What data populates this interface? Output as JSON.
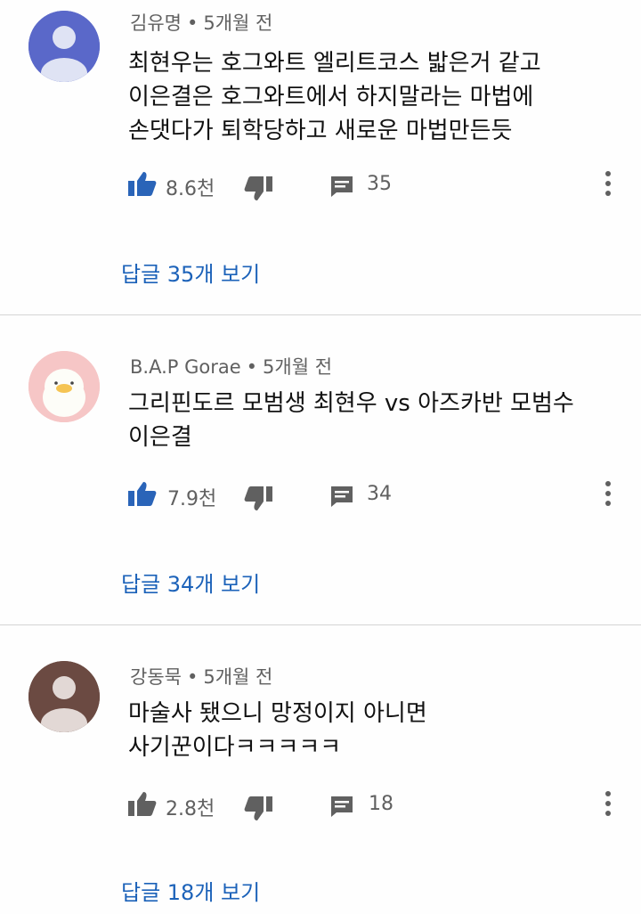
{
  "colors": {
    "accent_link": "#1c62b9",
    "meta_text": "#606060",
    "like_active": "#2a64b8",
    "like_inactive": "#606060"
  },
  "comments": [
    {
      "author": "김유명",
      "separator": "•",
      "time": "5개월 전",
      "avatar_icon": "default-user-avatar",
      "avatar_bg": "#5a68c9",
      "text_lines": [
        "최현우는 호그와트 엘리트코스 밟은거 같고",
        "이은결은 호그와트에서 하지말라는 마법에",
        "손댓다가 퇴학당하고 새로운 마법만든듯"
      ],
      "likes": "8.6천",
      "liked": true,
      "reply_count": "35",
      "view_replies": "답글 35개 보기"
    },
    {
      "author": "B.A.P Gorae",
      "separator": "•",
      "time": "5개월 전",
      "avatar_icon": "duck-character-avatar",
      "avatar_bg": "#f6c6c6",
      "text_lines": [
        "그리핀도르 모범생 최현우 vs 아즈카반 모범수",
        "이은결"
      ],
      "likes": "7.9천",
      "liked": true,
      "reply_count": "34",
      "view_replies": "답글 34개 보기"
    },
    {
      "author": "강동묵",
      "separator": "•",
      "time": "5개월 전",
      "avatar_icon": "default-user-avatar",
      "avatar_bg": "#6b4a42",
      "text_lines": [
        "마술사 됐으니 망정이지 아니면",
        "사기꾼이다ㅋㅋㅋㅋㅋ"
      ],
      "likes": "2.8천",
      "liked": false,
      "reply_count": "18",
      "view_replies": "답글 18개 보기"
    }
  ]
}
